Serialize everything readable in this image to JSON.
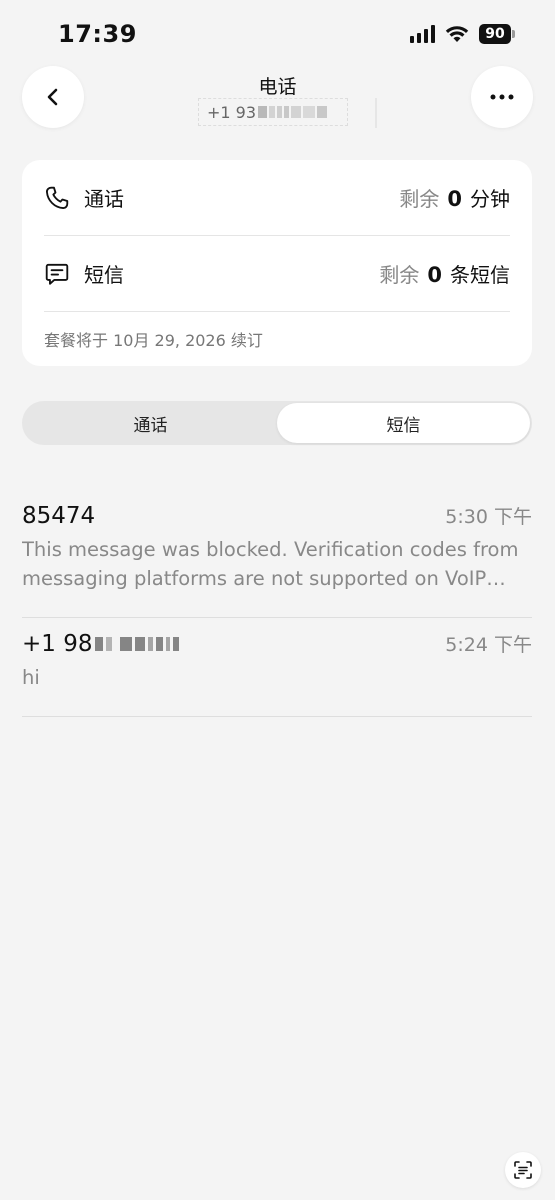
{
  "status_bar": {
    "time": "17:39",
    "battery": "90"
  },
  "header": {
    "title": "电话",
    "number_prefix": "+1 93"
  },
  "plan": {
    "calls": {
      "label": "通话",
      "remaining_prefix": "剩余",
      "remaining_value": "0",
      "remaining_unit": "分钟"
    },
    "sms": {
      "label": "短信",
      "remaining_prefix": "剩余",
      "remaining_value": "0",
      "remaining_unit": "条短信"
    },
    "renewal": "套餐将于 10月 29, 2026 续订"
  },
  "tabs": [
    {
      "label": "通话",
      "active": false
    },
    {
      "label": "短信",
      "active": true
    }
  ],
  "messages": [
    {
      "sender": "85474",
      "time": "5:30 下午",
      "preview": "This message was blocked. Verification codes from messaging platforms are not supported on VoIP numbers."
    },
    {
      "sender": "+1 98",
      "time": "5:24 下午",
      "preview": "hi"
    }
  ]
}
